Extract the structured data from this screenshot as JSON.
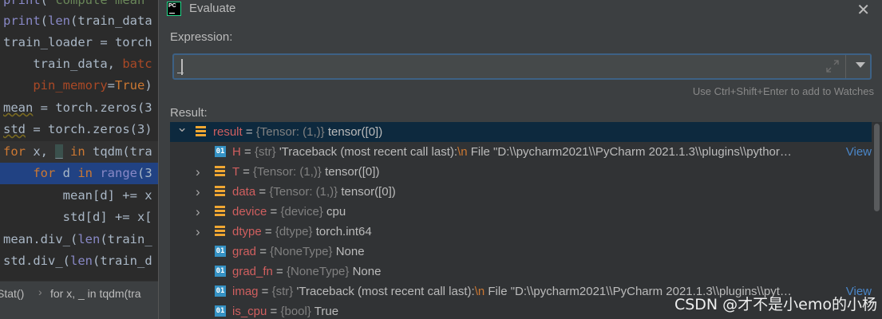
{
  "editor": {
    "lines": [
      {
        "t": "print( compute mean"
      },
      {
        "t": "print(len(train_data"
      },
      {
        "t": "train_loader = torch"
      },
      {
        "t": "    train_data, batc"
      },
      {
        "t": "    pin_memory=True)"
      },
      {
        "t": "mean = torch.zeros(3"
      },
      {
        "t": "std = torch.zeros(3)"
      },
      {
        "t": "for x, _ in tqdm(tra"
      },
      {
        "t": "    for d in range(3"
      },
      {
        "t": "        mean[d] += x"
      },
      {
        "t": "        std[d] += x["
      },
      {
        "t": "mean.div_(len(train_"
      },
      {
        "t": "std.div_(len(train_d"
      },
      {
        "t": ""
      }
    ],
    "breadcrumb": [
      "Stat()",
      "for x, _ in tqdm(tra"
    ]
  },
  "dialog": {
    "title": "Evaluate",
    "expression_label": "Expression:",
    "expression_value": "",
    "hint": "Use Ctrl+Shift+Enter to add to Watches",
    "result_label": "Result:",
    "view_link": "View",
    "rows": [
      {
        "name": "result",
        "type": "{Tensor: (1,)}",
        "value": "tensor([0])",
        "icon": "field",
        "expander": "expanded"
      },
      {
        "name": "H",
        "type": "{str}",
        "value": "'Traceback (most recent call last):",
        "nl": "\\n",
        "rest": "  File \"D:\\\\pycharm2021\\\\PyCharm 2021.1.3\\\\plugins\\\\pythor…",
        "icon": "01",
        "expander": "none",
        "view": true
      },
      {
        "name": "T",
        "type": "{Tensor: (1,)}",
        "value": "tensor([0])",
        "icon": "field",
        "expander": "collapsed"
      },
      {
        "name": "data",
        "type": "{Tensor: (1,)}",
        "value": "tensor([0])",
        "icon": "field",
        "expander": "collapsed"
      },
      {
        "name": "device",
        "type": "{device}",
        "value": "cpu",
        "icon": "field",
        "expander": "collapsed"
      },
      {
        "name": "dtype",
        "type": "{dtype}",
        "value": "torch.int64",
        "icon": "field",
        "expander": "collapsed"
      },
      {
        "name": "grad",
        "type": "{NoneType}",
        "value": "None",
        "icon": "01",
        "expander": "none"
      },
      {
        "name": "grad_fn",
        "type": "{NoneType}",
        "value": "None",
        "icon": "01",
        "expander": "none"
      },
      {
        "name": "imag",
        "type": "{str}",
        "value": "'Traceback (most recent call last):",
        "nl": "\\n",
        "rest": "  File \"D:\\\\pycharm2021\\\\PyCharm 2021.1.3\\\\plugins\\\\pyt…",
        "icon": "01",
        "expander": "none",
        "view": true
      },
      {
        "name": "is_cpu",
        "type": "{bool}",
        "value": "True",
        "icon": "01",
        "expander": "none"
      }
    ]
  },
  "watermark": "CSDN @才不是小emo的小杨",
  "colors": {
    "accent": "#3d6185",
    "selection": "#0d293e",
    "field_icon": "#f0a732",
    "primitive_icon": "#3592c4",
    "name": "#d05f5f",
    "link": "#4a86c8"
  }
}
